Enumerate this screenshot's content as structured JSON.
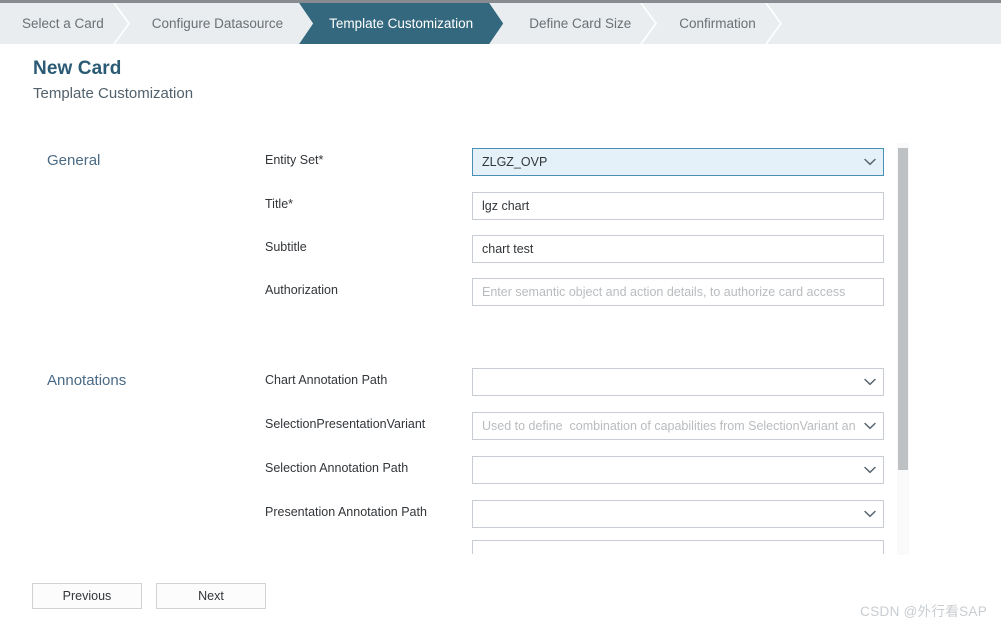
{
  "wizard": {
    "steps": [
      {
        "label": "Select a Card",
        "state": "done"
      },
      {
        "label": "Configure Datasource",
        "state": "done"
      },
      {
        "label": "Template Customization",
        "state": "active"
      },
      {
        "label": "Define Card Size",
        "state": "upcoming"
      },
      {
        "label": "Confirmation",
        "state": "upcoming"
      }
    ],
    "active_color": "#34687e",
    "bar_color": "#e9edef"
  },
  "page": {
    "title": "New Card",
    "subtitle": "Template Customization",
    "title_color": "#2b5a74"
  },
  "sections": [
    {
      "name": "general",
      "label": "General",
      "fields": [
        {
          "name": "entity-set",
          "label": "Entity Set*",
          "control": "select",
          "value": "ZLGZ_OVP",
          "placeholder": "",
          "highlighted": true
        },
        {
          "name": "title",
          "label": "Title*",
          "control": "input",
          "value": "lgz chart",
          "placeholder": "",
          "highlighted": false
        },
        {
          "name": "subtitle",
          "label": "Subtitle",
          "control": "input",
          "value": "chart test",
          "placeholder": "",
          "highlighted": false
        },
        {
          "name": "authorization",
          "label": "Authorization",
          "control": "input",
          "value": "",
          "placeholder": "Enter semantic object and action details, to authorize card access",
          "highlighted": false
        }
      ]
    },
    {
      "name": "annotations",
      "label": "Annotations",
      "fields": [
        {
          "name": "chart-annotation-path",
          "label": "Chart Annotation Path",
          "control": "select",
          "value": "",
          "placeholder": "",
          "highlighted": false
        },
        {
          "name": "selection-presentation-variant",
          "label": "SelectionPresentationVariant",
          "control": "select",
          "value": "",
          "placeholder": "Used to define  combination of capabilities from SelectionVariant and ",
          "highlighted": false
        },
        {
          "name": "selection-annotation-path",
          "label": "Selection Annotation Path",
          "control": "select",
          "value": "",
          "placeholder": "",
          "highlighted": false
        },
        {
          "name": "presentation-annotation-path",
          "label": "Presentation Annotation Path",
          "control": "select",
          "value": "",
          "placeholder": "",
          "highlighted": false
        }
      ]
    }
  ],
  "footer": {
    "previous_label": "Previous",
    "next_label": "Next"
  },
  "watermark": {
    "text": "CSDN @外行看SAP"
  }
}
